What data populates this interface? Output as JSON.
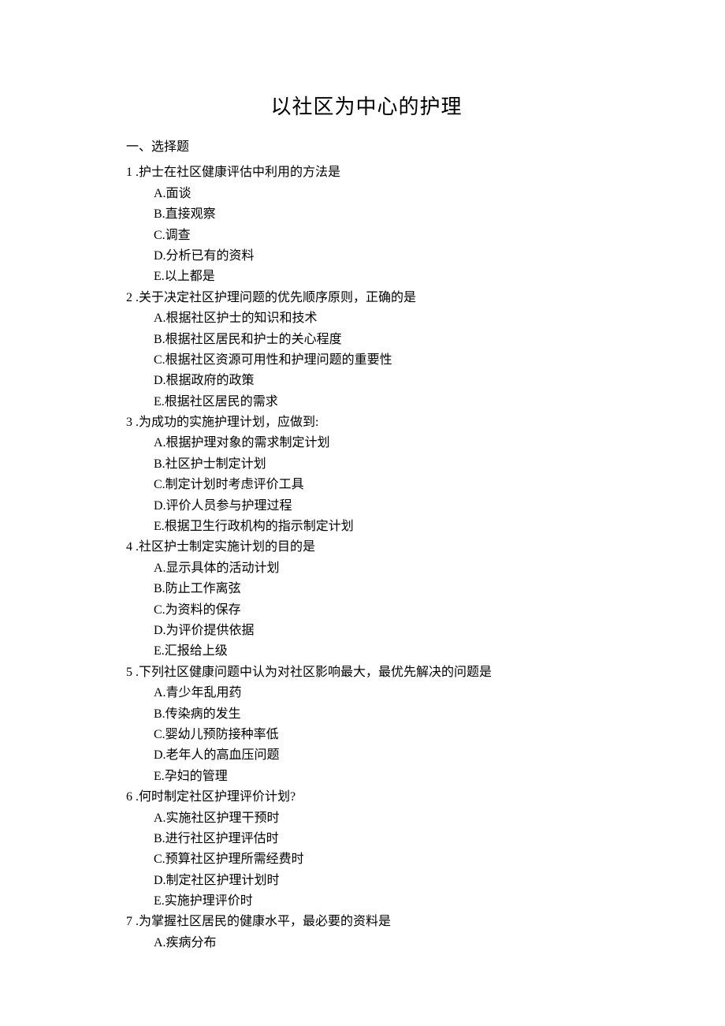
{
  "title": "以社区为中心的护理",
  "section_header": "一、选择题",
  "questions": [
    {
      "num": "1",
      "sep": " .",
      "text": "护士在社区健康评估中利用的方法是",
      "options": [
        "A.面谈",
        "B.直接观察",
        "C.调查",
        "D.分析已有的资料",
        "E.以上都是"
      ]
    },
    {
      "num": "2",
      "sep": "  .",
      "text": "关于决定社区护理问题的优先顺序原则，正确的是",
      "options": [
        "A.根据社区护士的知识和技术",
        "B.根据社区居民和护士的关心程度",
        "C.根据社区资源可用性和护理问题的重要性",
        "D.根据政府的政策",
        "E.根据社区居民的需求"
      ]
    },
    {
      "num": "3",
      "sep": "  .",
      "text": "为成功的实施护理计划，应做到:",
      "options": [
        "A.根据护理对象的需求制定计划",
        "B.社区护士制定计划",
        "C.制定计划时考虑评价工具",
        "D.评价人员参与护理过程",
        "E.根据卫生行政机构的指示制定计划"
      ]
    },
    {
      "num": "4",
      "sep": "  .",
      "text": "社区护士制定实施计划的目的是",
      "options": [
        "A.显示具体的活动计划",
        "B.防止工作离弦",
        "C.为资料的保存",
        "D.为评价提供依据",
        "E.汇报给上级"
      ]
    },
    {
      "num": "5",
      "sep": "  .",
      "text": "下列社区健康问题中认为对社区影响最大，最优先解决的问题是",
      "options": [
        "A.青少年乱用药",
        "B.传染病的发生",
        "C.婴幼儿预防接种率低",
        "D.老年人的高血压问题",
        "E.孕妇的管理"
      ]
    },
    {
      "num": "6",
      "sep": "  .",
      "text": "何时制定社区护理评价计划?",
      "options": [
        "A.实施社区护理干预时",
        "B.进行社区护理评估时",
        "C.预算社区护理所需经费时",
        "D.制定社区护理计划时",
        "E.实施护理评价时"
      ]
    },
    {
      "num": "7",
      "sep": "  .",
      "text": "为掌握社区居民的健康水平，最必要的资料是",
      "options": [
        "A.疾病分布"
      ]
    }
  ]
}
